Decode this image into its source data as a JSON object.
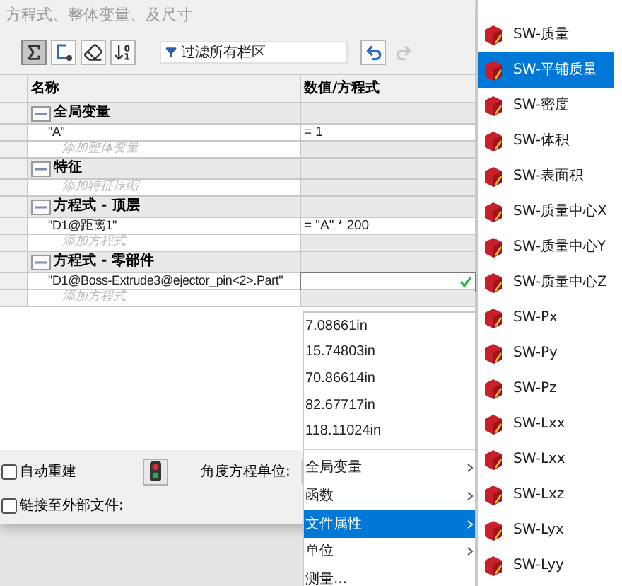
{
  "window": {
    "title": "方程式、整体变量、及尺寸"
  },
  "toolbar": {
    "buttons": [
      {
        "kind": "sum",
        "selected": true
      },
      {
        "kind": "bracket",
        "selected": false
      },
      {
        "kind": "eraser",
        "selected": false
      },
      {
        "kind": "order",
        "selected": false
      }
    ],
    "filter": {
      "placeholder": "过滤所有栏区"
    },
    "undo": {
      "disabled": false
    },
    "redo": {
      "disabled": true
    }
  },
  "table": {
    "columns": [
      "名称",
      "数值/方程式"
    ],
    "rows": [
      {
        "kind": "group",
        "name": "全局变量"
      },
      {
        "kind": "item",
        "name": "\"A\"",
        "value": "= 1",
        "editing": false
      },
      {
        "kind": "add",
        "name": "添加整体变量"
      },
      {
        "kind": "group",
        "name": "特征"
      },
      {
        "kind": "add",
        "name": "添加特征压缩"
      },
      {
        "kind": "group",
        "name": "方程式 - 顶层"
      },
      {
        "kind": "item",
        "name": "\"D1@距离1\"",
        "value": "= \"A\" * 200",
        "editing": false
      },
      {
        "kind": "add",
        "name": "添加方程式"
      },
      {
        "kind": "group",
        "name": "方程式 - 零部件"
      },
      {
        "kind": "item",
        "name": "\"D1@Boss-Extrude3@ejector_pin<2>.Part\"",
        "value": "",
        "editing": true
      },
      {
        "kind": "add",
        "name": "添加方程式"
      }
    ]
  },
  "options": {
    "checkboxes": [
      {
        "label": "自动重建",
        "checked": false
      },
      {
        "label": "链接至外部文件:",
        "checked": false
      }
    ],
    "angle_units_label": "角度方程单位:"
  },
  "value_menu": {
    "values": [
      "7.08661in",
      "15.74803in",
      "70.86614in",
      "82.67717in",
      "118.11024in"
    ],
    "items": [
      {
        "label": "全局变量",
        "submenu": true,
        "selected": false
      },
      {
        "label": "函数",
        "submenu": true,
        "selected": false
      },
      {
        "label": "文件属性",
        "submenu": true,
        "selected": true
      },
      {
        "label": "单位",
        "submenu": true,
        "selected": false
      },
      {
        "label": "测量...",
        "submenu": false,
        "selected": false
      }
    ]
  },
  "properties_menu": {
    "items": [
      {
        "label": "SW-质量",
        "selected": false
      },
      {
        "label": "SW-平铺质量",
        "selected": true
      },
      {
        "label": "SW-密度",
        "selected": false
      },
      {
        "label": "SW-体积",
        "selected": false
      },
      {
        "label": "SW-表面积",
        "selected": false
      },
      {
        "label": "SW-质量中心X",
        "selected": false
      },
      {
        "label": "SW-质量中心Y",
        "selected": false
      },
      {
        "label": "SW-质量中心Z",
        "selected": false
      },
      {
        "label": "SW-Px",
        "selected": false
      },
      {
        "label": "SW-Py",
        "selected": false
      },
      {
        "label": "SW-Pz",
        "selected": false
      },
      {
        "label": "SW-Lxx",
        "selected": false
      },
      {
        "label": "SW-Lxx",
        "selected": false
      },
      {
        "label": "SW-Lxz",
        "selected": false
      },
      {
        "label": "SW-Lyx",
        "selected": false
      },
      {
        "label": "SW-Lyy",
        "selected": false
      }
    ]
  }
}
